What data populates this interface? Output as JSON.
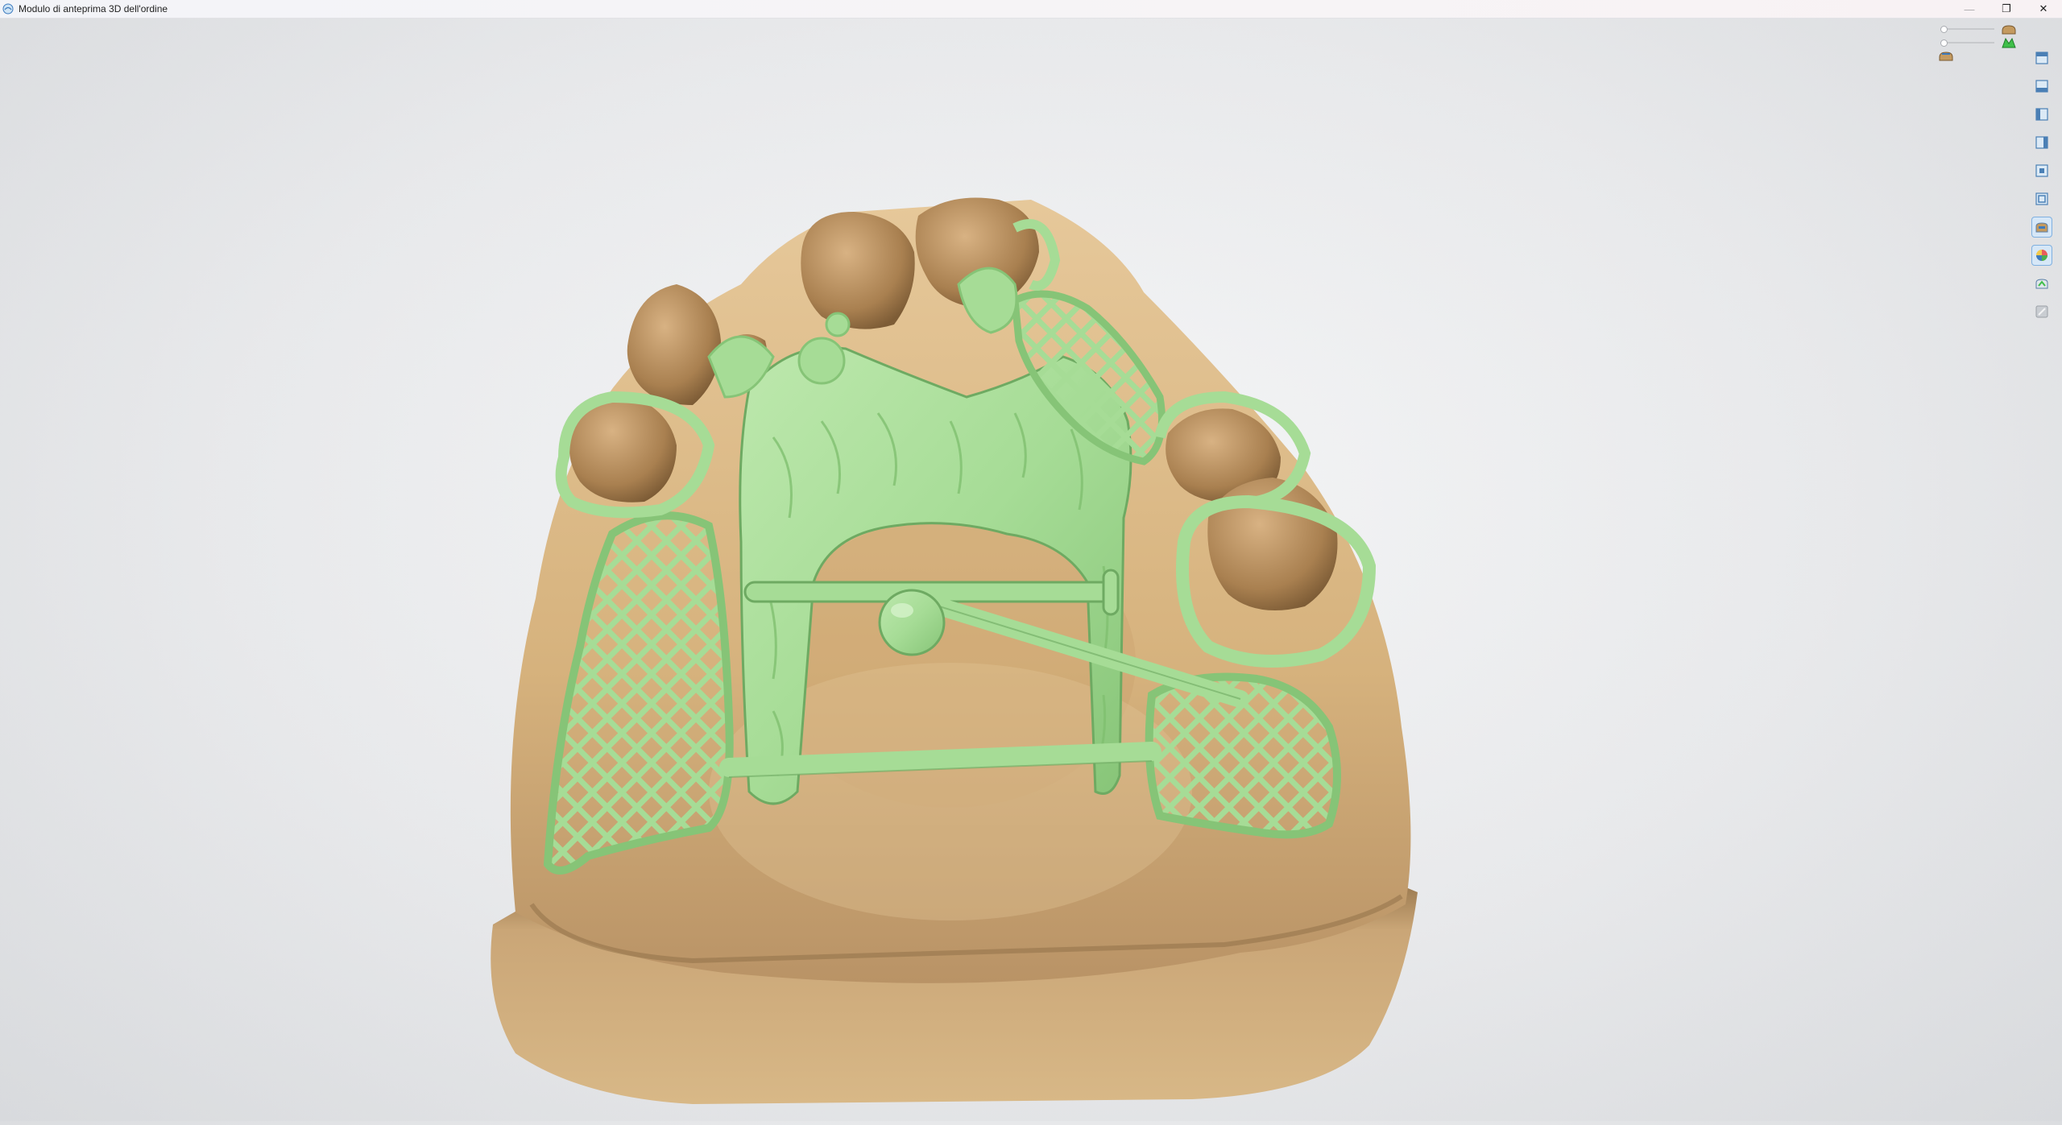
{
  "window": {
    "title": "Modulo di anteprima 3D dell'ordine",
    "controls": {
      "minimize": "—",
      "restore": "❐",
      "close": "✕"
    }
  },
  "viewport": {
    "model_colors": {
      "base": "#d9b784",
      "base_shadow": "#a88454",
      "framework": "#a6dc96",
      "framework_shadow": "#6eaa62",
      "teeth": "#bd9260"
    },
    "sliders": [
      {
        "name": "model-transparency-slider",
        "value": 0,
        "icon": "model-base-icon"
      },
      {
        "name": "framework-transparency-slider",
        "value": 0,
        "icon": "framework-icon"
      }
    ],
    "extra_toggle_icon": "model-toggle-icon"
  },
  "toolbar": {
    "items": [
      {
        "icon": "view-top-icon",
        "active": false
      },
      {
        "icon": "view-bottom-icon",
        "active": false
      },
      {
        "icon": "view-left-icon",
        "active": false
      },
      {
        "icon": "view-right-icon",
        "active": false
      },
      {
        "icon": "view-front-icon",
        "active": false
      },
      {
        "icon": "view-back-icon",
        "active": false
      },
      {
        "icon": "model-visibility-icon",
        "active": true
      },
      {
        "icon": "color-map-icon",
        "active": true
      },
      {
        "icon": "scan-visibility-icon",
        "active": false
      },
      {
        "icon": "measure-disabled-icon",
        "active": false
      }
    ]
  }
}
